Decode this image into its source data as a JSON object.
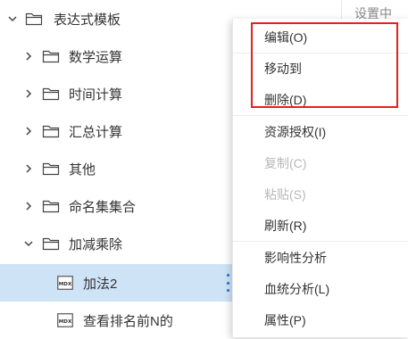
{
  "tree": {
    "root": {
      "label": "表达式模板",
      "expanded": true
    },
    "folders": [
      {
        "label": "数学运算",
        "expanded": false
      },
      {
        "label": "时间计算",
        "expanded": false
      },
      {
        "label": "汇总计算",
        "expanded": false
      },
      {
        "label": "其他",
        "expanded": false
      },
      {
        "label": "命名集集合",
        "expanded": false
      },
      {
        "label": "加减乘除",
        "expanded": true
      }
    ],
    "items": [
      {
        "label": "加法2",
        "icon": "mdx-file-icon",
        "selected": true
      },
      {
        "label": "查看排名前N的",
        "icon": "mdx-file-icon",
        "selected": false
      }
    ],
    "icon_text": "MDX"
  },
  "peek": {
    "text": "设置中"
  },
  "context_menu": {
    "items": [
      {
        "label": "编辑(O)",
        "enabled": true
      },
      {
        "label": "移动到",
        "enabled": true
      },
      {
        "label": "删除(D)",
        "enabled": true
      },
      {
        "label": "资源授权(I)",
        "enabled": true
      },
      {
        "label": "复制(C)",
        "enabled": false
      },
      {
        "label": "粘贴(S)",
        "enabled": false
      },
      {
        "label": "刷新(R)",
        "enabled": true
      },
      {
        "label": "影响性分析",
        "enabled": true
      },
      {
        "label": "血统分析(L)",
        "enabled": true
      },
      {
        "label": "属性(P)",
        "enabled": true
      }
    ],
    "highlight_color": "#ef1c1c"
  },
  "colors": {
    "selection": "#cfe3f7",
    "more_dots": "#1f6fd1",
    "disabled_text": "#b8b8b8"
  }
}
